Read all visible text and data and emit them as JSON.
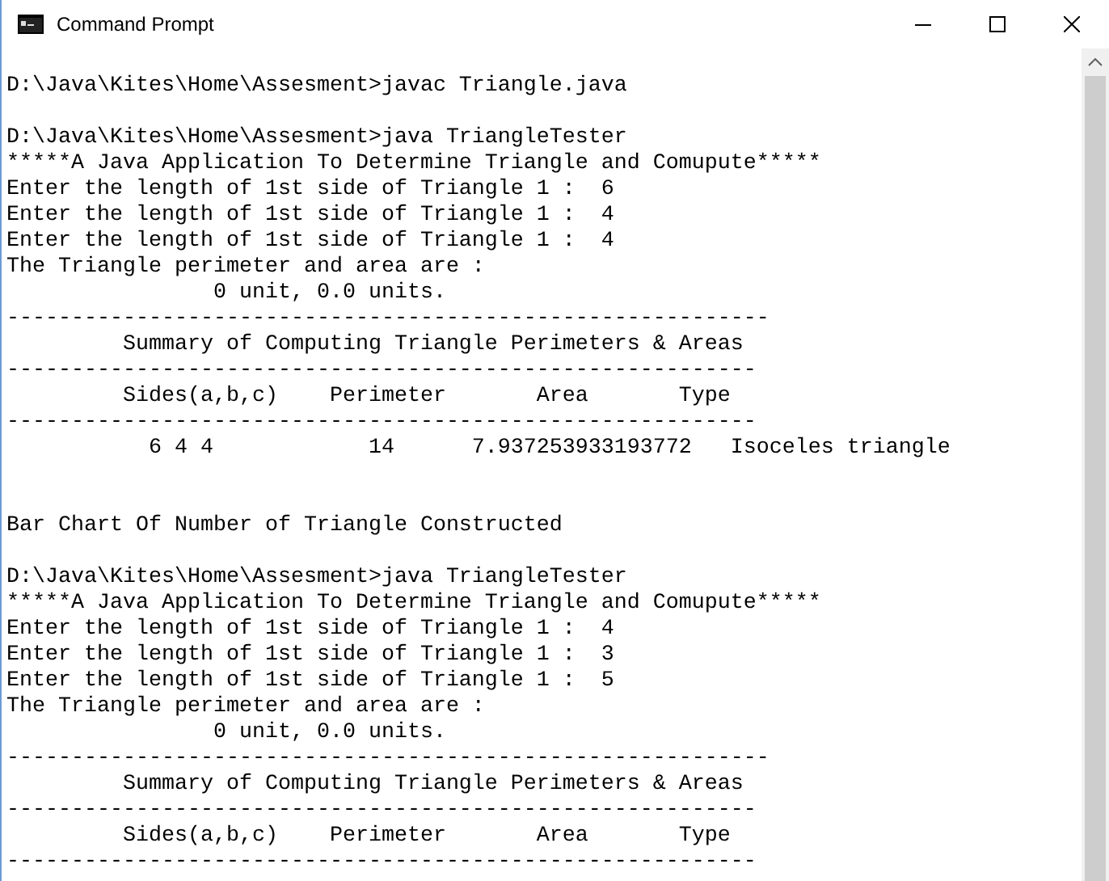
{
  "window": {
    "title": "Command Prompt"
  },
  "console_lines": [
    {
      "kind": "text",
      "text": "D:\\Java\\Kites\\Home\\Assesment>javac Triangle.java"
    },
    {
      "kind": "blank"
    },
    {
      "kind": "text",
      "text": "D:\\Java\\Kites\\Home\\Assesment>java TriangleTester"
    },
    {
      "kind": "text",
      "text": "*****A Java Application To Determine Triangle and Comupute*****"
    },
    {
      "kind": "text",
      "text": "Enter the length of 1st side of Triangle 1 :  6"
    },
    {
      "kind": "text",
      "text": "Enter the length of 1st side of Triangle 1 :  4"
    },
    {
      "kind": "text",
      "text": "Enter the length of 1st side of Triangle 1 :  4"
    },
    {
      "kind": "text",
      "text": "The Triangle perimeter and area are :"
    },
    {
      "kind": "text",
      "text": "                0 unit, 0.0 units."
    },
    {
      "kind": "text",
      "text": "-----------------------------------------------------------"
    },
    {
      "kind": "text",
      "text": "         Summary of Computing Triangle Perimeters & Areas"
    },
    {
      "kind": "text",
      "text": "----------------------------------------------------------"
    },
    {
      "kind": "text",
      "text": "         Sides(a,b,c)    Perimeter       Area       Type"
    },
    {
      "kind": "text",
      "text": "----------------------------------------------------------"
    },
    {
      "kind": "text",
      "text": "           6 4 4            14      7.937253933193772   Isoceles triangle"
    },
    {
      "kind": "blank"
    },
    {
      "kind": "blank"
    },
    {
      "kind": "text",
      "text": "Bar Chart Of Number of Triangle Constructed"
    },
    {
      "kind": "blank"
    },
    {
      "kind": "text",
      "text": "D:\\Java\\Kites\\Home\\Assesment>java TriangleTester"
    },
    {
      "kind": "text",
      "text": "*****A Java Application To Determine Triangle and Comupute*****"
    },
    {
      "kind": "text",
      "text": "Enter the length of 1st side of Triangle 1 :  4"
    },
    {
      "kind": "text",
      "text": "Enter the length of 1st side of Triangle 1 :  3"
    },
    {
      "kind": "text",
      "text": "Enter the length of 1st side of Triangle 1 :  5"
    },
    {
      "kind": "text",
      "text": "The Triangle perimeter and area are :"
    },
    {
      "kind": "text",
      "text": "                0 unit, 0.0 units."
    },
    {
      "kind": "text",
      "text": "-----------------------------------------------------------"
    },
    {
      "kind": "text",
      "text": "         Summary of Computing Triangle Perimeters & Areas"
    },
    {
      "kind": "text",
      "text": "----------------------------------------------------------"
    },
    {
      "kind": "text",
      "text": "         Sides(a,b,c)    Perimeter       Area       Type"
    },
    {
      "kind": "text",
      "text": "----------------------------------------------------------"
    }
  ]
}
